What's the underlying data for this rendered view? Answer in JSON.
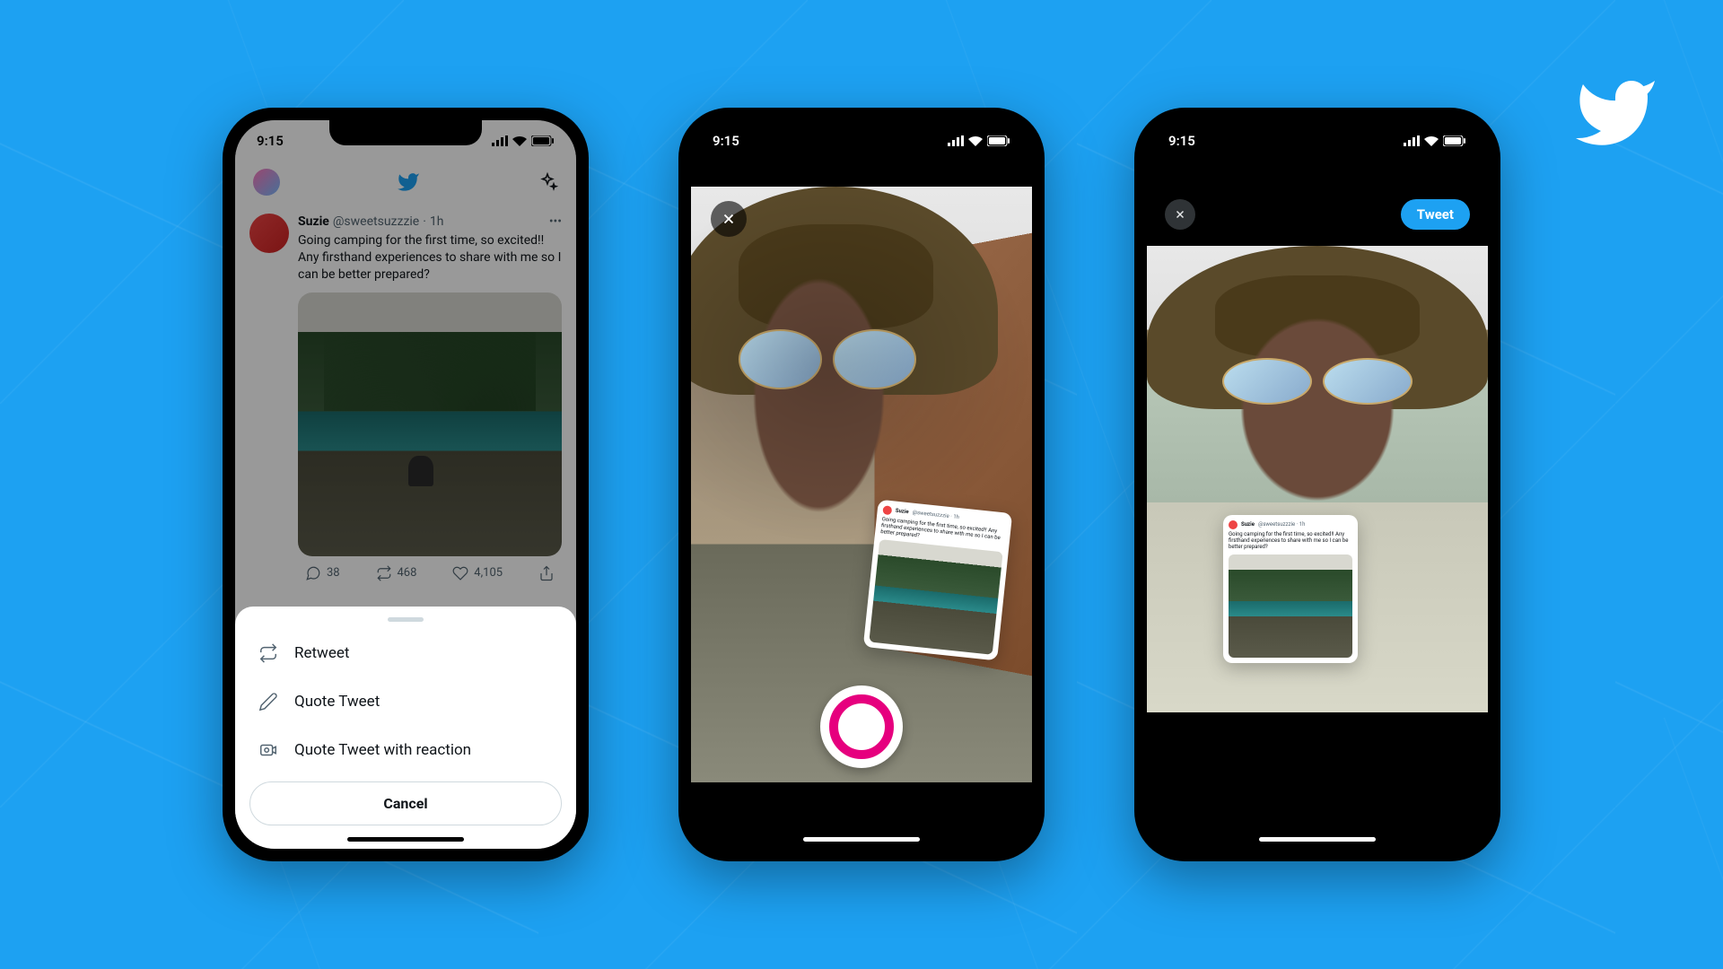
{
  "status": {
    "time": "9:15"
  },
  "tweet": {
    "name": "Suzie",
    "handle": "@sweetsuzzzie",
    "time": "1h",
    "text": "Going camping for the first time, so excited!! Any firsthand experiences to share with me so I can be better prepared?",
    "replies": "38",
    "retweets": "468",
    "likes": "4,105"
  },
  "sheet": {
    "retweet": "Retweet",
    "quote": "Quote Tweet",
    "reaction": "Quote Tweet with reaction",
    "cancel": "Cancel"
  },
  "compose": {
    "tweet_button": "Tweet"
  },
  "mini_tweet": {
    "name": "Suzie",
    "handle": "@sweetsuzzzie · 1h",
    "text": "Going camping for the first time, so excited!! Any firsthand experiences to share with me so I can be better prepared?"
  }
}
